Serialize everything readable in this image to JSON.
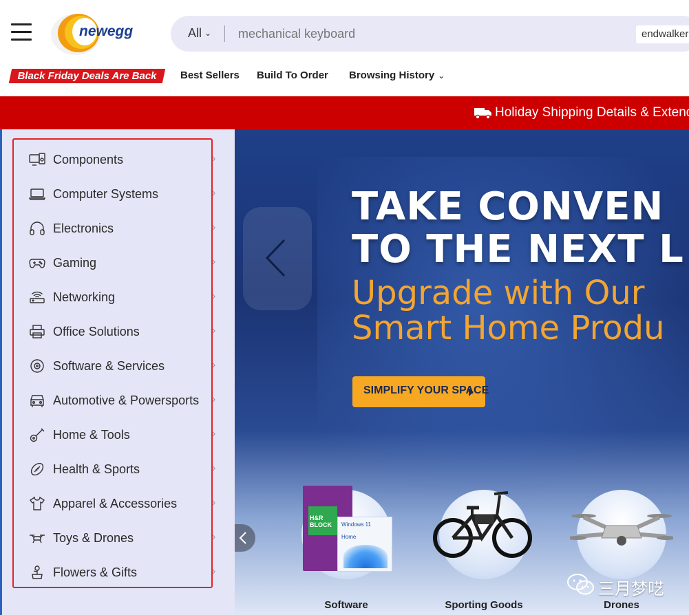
{
  "header": {
    "logo_text": "newegg",
    "search": {
      "category": "All",
      "placeholder": "mechanical keyboard",
      "chip": "endwalker"
    },
    "black_friday_badge": "Black Friday Deals Are Back",
    "nav": [
      {
        "label": "Best Sellers"
      },
      {
        "label": "Build To Order"
      },
      {
        "label": "Browsing History"
      }
    ]
  },
  "promo_bar": {
    "text": "Holiday Shipping Details & Extende",
    "icon": "truck-icon"
  },
  "menu": {
    "items": [
      {
        "label": "Components",
        "icon": "components-icon"
      },
      {
        "label": "Computer Systems",
        "icon": "laptop-icon"
      },
      {
        "label": "Electronics",
        "icon": "headphones-icon"
      },
      {
        "label": "Gaming",
        "icon": "gamepad-icon"
      },
      {
        "label": "Networking",
        "icon": "router-icon"
      },
      {
        "label": "Office Solutions",
        "icon": "printer-icon"
      },
      {
        "label": "Software & Services",
        "icon": "disc-icon"
      },
      {
        "label": "Automotive & Powersports",
        "icon": "car-icon"
      },
      {
        "label": "Home & Tools",
        "icon": "guitar-icon"
      },
      {
        "label": "Health & Sports",
        "icon": "football-icon"
      },
      {
        "label": "Apparel & Accessories",
        "icon": "tshirt-icon"
      },
      {
        "label": "Toys & Drones",
        "icon": "drone-icon"
      },
      {
        "label": "Flowers & Gifts",
        "icon": "gift-icon"
      }
    ]
  },
  "hero": {
    "headline_1": "TAKE CONVEN",
    "headline_2": "TO THE NEXT L",
    "subline_1": "Upgrade with Our",
    "subline_2": "Smart Home Produ",
    "cta": "SIMPLIFY YOUR SPACE",
    "categories": [
      {
        "label": "Software"
      },
      {
        "label": "Sporting Goods"
      },
      {
        "label": "Drones"
      }
    ],
    "product_texts": {
      "hr_block": "H&R BLOCK",
      "windows": "Windows 11",
      "windows_sub": "Home"
    }
  },
  "watermark": {
    "text": "三月梦呓"
  },
  "colors": {
    "brand_red": "#cc0000",
    "accent_orange": "#f7a823",
    "menu_bg": "#e4e5f6",
    "highlight_border": "#e0242a"
  }
}
